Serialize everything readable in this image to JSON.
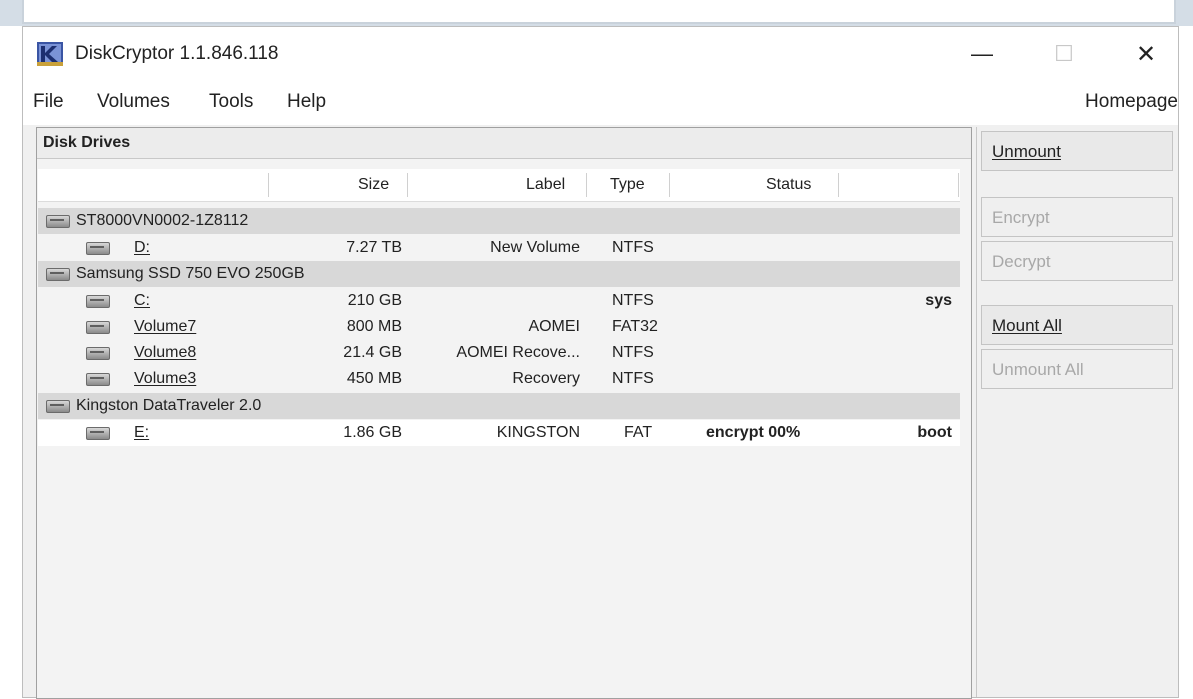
{
  "window": {
    "title": "DiskCryptor 1.1.846.118"
  },
  "menu": {
    "file": "File",
    "volumes": "Volumes",
    "tools": "Tools",
    "help": "Help",
    "homepage": "Homepage"
  },
  "panel": {
    "title": "Disk Drives"
  },
  "columns": {
    "size": "Size",
    "label": "Label",
    "type": "Type",
    "status": "Status"
  },
  "disks": [
    {
      "name": "ST8000VN0002-1Z8112"
    },
    {
      "name": "Samsung SSD 750 EVO 250GB"
    },
    {
      "name": "Kingston DataTraveler 2.0"
    }
  ],
  "volumes": [
    {
      "name": "D:",
      "size": "7.27 TB",
      "label": "New Volume",
      "type": "NTFS",
      "status": "",
      "flag": ""
    },
    {
      "name": "C:",
      "size": "210 GB",
      "label": "",
      "type": "NTFS",
      "status": "",
      "flag": "sys"
    },
    {
      "name": "Volume7",
      "size": "800 MB",
      "label": "AOMEI",
      "type": "FAT32",
      "status": "",
      "flag": ""
    },
    {
      "name": "Volume8",
      "size": "21.4 GB",
      "label": "AOMEI Recove...",
      "type": "NTFS",
      "status": "",
      "flag": ""
    },
    {
      "name": "Volume3",
      "size": "450 MB",
      "label": "Recovery",
      "type": "NTFS",
      "status": "",
      "flag": ""
    },
    {
      "name": "E:",
      "size": "1.86 GB",
      "label": "KINGSTON",
      "type": "FAT",
      "status": "encrypt 00%",
      "flag": "boot"
    }
  ],
  "buttons": {
    "unmount": "Unmount",
    "encrypt": "Encrypt",
    "decrypt": "Decrypt",
    "mount_all": "Mount All",
    "unmount_all": "Unmount All"
  },
  "icons": {
    "app": "diskcryptor-app-icon",
    "drive": "drive-icon"
  },
  "colors": {
    "disk_row_bg": "#d8d8d8",
    "selected_row_bg": "#ffffff",
    "disabled_text": "#a8a8a8"
  }
}
